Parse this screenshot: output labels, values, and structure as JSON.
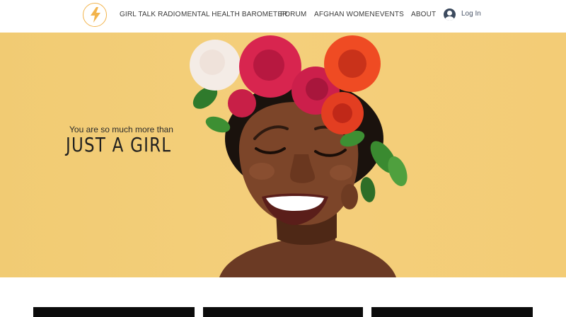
{
  "header": {
    "logo": {
      "icon": "lightning-bolt-icon",
      "color": "#f2b44c"
    },
    "nav": [
      {
        "label": "GIRL TALK RADIO"
      },
      {
        "label": "MENTAL HEALTH BAROMETER"
      },
      {
        "label": "FORUM"
      },
      {
        "label": "AFGHAN WOMEN"
      },
      {
        "label": "EVENTS"
      },
      {
        "label": "ABOUT"
      }
    ],
    "login": {
      "icon": "user-avatar-icon",
      "label": "Log In"
    }
  },
  "hero": {
    "tagline": "You are so much more than",
    "headline": "JUST A GIRL",
    "background_color": "#f3cd77",
    "image": "smiling-woman-flower-crown-photo"
  },
  "cards": [
    {
      "color": "#0b0b0b"
    },
    {
      "color": "#0b0b0b"
    },
    {
      "color": "#0b0b0b"
    }
  ]
}
